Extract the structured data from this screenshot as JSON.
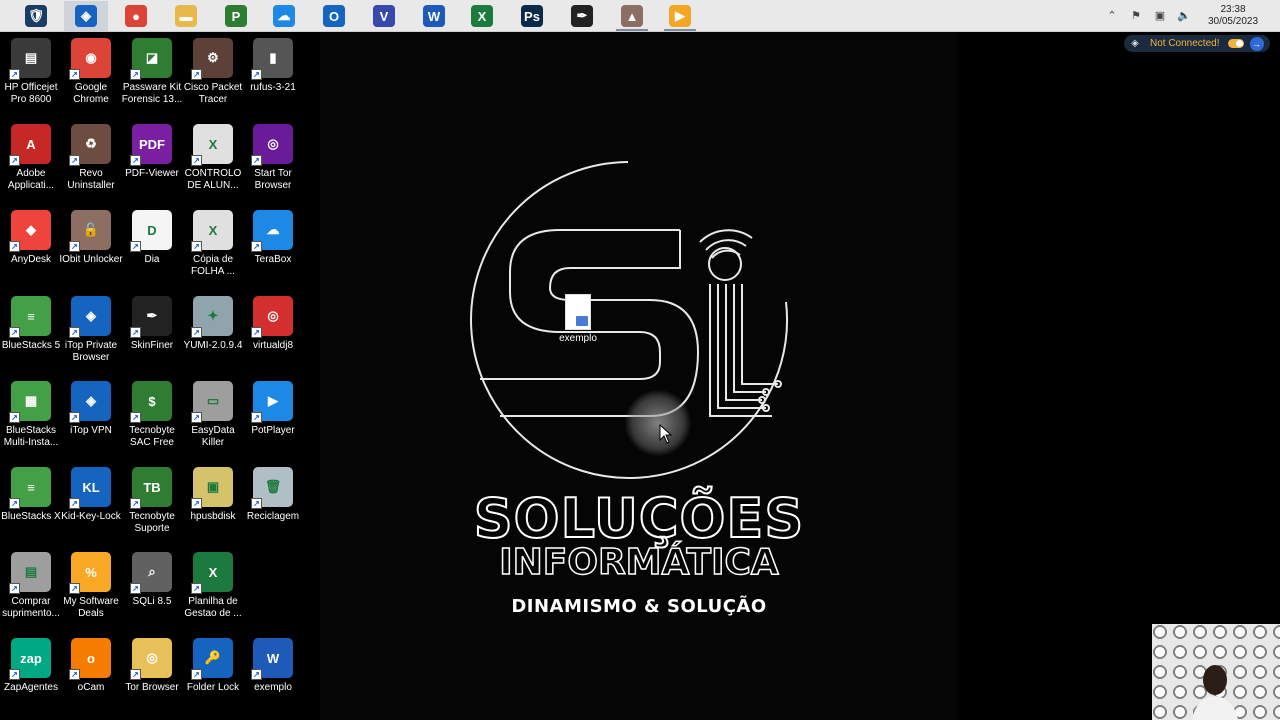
{
  "taskbar": {
    "apps": [
      {
        "name": "Windows Defender Security",
        "icon": "shield-icon",
        "color": "#1a3c64",
        "glyph": "🛡"
      },
      {
        "name": "iTop VPN",
        "icon": "vpn-shield-icon",
        "color": "#1565c0",
        "glyph": "◈",
        "active": true
      },
      {
        "name": "Google Chrome",
        "icon": "chrome-icon",
        "color": "#db4437",
        "glyph": "●"
      },
      {
        "name": "File Explorer",
        "icon": "folder-icon",
        "color": "#e8b84a",
        "glyph": "▬"
      },
      {
        "name": "Project",
        "icon": "project-icon",
        "color": "#2e7d32",
        "glyph": "P"
      },
      {
        "name": "TeraBox",
        "icon": "cloud-upload-icon",
        "color": "#1e88e5",
        "glyph": "☁"
      },
      {
        "name": "Outlook",
        "icon": "outlook-icon",
        "color": "#1565c0",
        "glyph": "O"
      },
      {
        "name": "Visio",
        "icon": "visio-icon",
        "color": "#3949ab",
        "glyph": "V"
      },
      {
        "name": "Word",
        "icon": "word-icon",
        "color": "#1e5bb8",
        "glyph": "W"
      },
      {
        "name": "Excel",
        "icon": "excel-icon",
        "color": "#1d7a3e",
        "glyph": "X"
      },
      {
        "name": "Photoshop",
        "icon": "photoshop-icon",
        "color": "#0b2a4a",
        "glyph": "Ps"
      },
      {
        "name": "SkinFiner",
        "icon": "feather-icon",
        "color": "#222222",
        "glyph": "✒"
      },
      {
        "name": "Taskbar App",
        "icon": "hat-icon",
        "color": "#8d6e63",
        "glyph": "▲",
        "running": true
      },
      {
        "name": "Video Player",
        "icon": "play-icon",
        "color": "#f5a623",
        "glyph": "▶",
        "running": true
      }
    ]
  },
  "tray": {
    "time": "23:38",
    "date": "30/05/2023"
  },
  "vpn_status": {
    "label": "Not Connected!"
  },
  "desktop_icons": [
    {
      "label": "HP Officejet Pro 8600",
      "icon": "printer-icon",
      "color": "#3a3a3a",
      "glyph": "▤"
    },
    {
      "label": "Google Chrome",
      "icon": "chrome-icon",
      "color": "#db4437",
      "glyph": "◉"
    },
    {
      "label": "Passware Kit Forensic 13...",
      "icon": "passware-icon",
      "color": "#2e7d32",
      "glyph": "◪"
    },
    {
      "label": "Cisco Packet Tracer",
      "icon": "cisco-icon",
      "color": "#5d4037",
      "glyph": "⚙"
    },
    {
      "label": "rufus-3-21",
      "icon": "usb-icon",
      "color": "#555555",
      "glyph": "▮"
    },
    {
      "label": "Adobe Applicati...",
      "icon": "adobe-icon",
      "color": "#c62828",
      "glyph": "A"
    },
    {
      "label": "Revo Uninstaller",
      "icon": "revo-icon",
      "color": "#6d4c41",
      "glyph": "♻"
    },
    {
      "label": "PDF-Viewer",
      "icon": "pdf-icon",
      "color": "#7b1fa2",
      "glyph": "PDF"
    },
    {
      "label": "CONTROLO DE ALUN...",
      "icon": "excel-file-icon",
      "color": "#e0e0e0",
      "glyph": "X"
    },
    {
      "label": "Start Tor Browser",
      "icon": "tor-icon",
      "color": "#6a1b9a",
      "glyph": "◎"
    },
    {
      "label": "AnyDesk",
      "icon": "anydesk-icon",
      "color": "#ef443b",
      "glyph": "◆"
    },
    {
      "label": "IObit Unlocker",
      "icon": "unlock-icon",
      "color": "#8d6e63",
      "glyph": "🔓"
    },
    {
      "label": "Dia",
      "icon": "dia-icon",
      "color": "#f5f5f5",
      "glyph": "D"
    },
    {
      "label": "Cópia de FOLHA ...",
      "icon": "excel-file-icon",
      "color": "#e0e0e0",
      "glyph": "X"
    },
    {
      "label": "TeraBox",
      "icon": "cloud-upload-icon",
      "color": "#1e88e5",
      "glyph": "☁"
    },
    {
      "label": "BlueStacks 5",
      "icon": "bluestacks-icon",
      "color": "#43a047",
      "glyph": "≡"
    },
    {
      "label": "iTop Private Browser",
      "icon": "itop-browser-icon",
      "color": "#1565c0",
      "glyph": "◈"
    },
    {
      "label": "SkinFiner",
      "icon": "feather-icon",
      "color": "#222222",
      "glyph": "✒"
    },
    {
      "label": "YUMI-2.0.9.4",
      "icon": "yumi-icon",
      "color": "#90a4ae",
      "glyph": "✦"
    },
    {
      "label": "virtualdj8",
      "icon": "vdj-icon",
      "color": "#d32f2f",
      "glyph": "◎"
    },
    {
      "label": "BlueStacks Multi-Insta...",
      "icon": "bluestacks-multi-icon",
      "color": "#43a047",
      "glyph": "▦"
    },
    {
      "label": "iTop VPN",
      "icon": "vpn-shield-icon",
      "color": "#1565c0",
      "glyph": "◈"
    },
    {
      "label": "Tecnobyte SAC Free",
      "icon": "tecnobyte-icon",
      "color": "#2e7d32",
      "glyph": "$"
    },
    {
      "label": "EasyData Killer",
      "icon": "harddisk-icon",
      "color": "#9e9e9e",
      "glyph": "▭"
    },
    {
      "label": "PotPlayer",
      "icon": "play-icon",
      "color": "#1e88e5",
      "glyph": "▶"
    },
    {
      "label": "BlueStacks X",
      "icon": "bluestacks-x-icon",
      "color": "#43a047",
      "glyph": "≡"
    },
    {
      "label": "Kid-Key-Lock",
      "icon": "key-icon",
      "color": "#1565c0",
      "glyph": "KL"
    },
    {
      "label": "Tecnobyte Suporte",
      "icon": "tecnobyte-icon",
      "color": "#2e7d32",
      "glyph": "TB"
    },
    {
      "label": "hpusbdisk",
      "icon": "usbdisk-icon",
      "color": "#d4c36a",
      "glyph": "▣"
    },
    {
      "label": "Reciclagem",
      "icon": "recycle-bin-icon",
      "color": "#b0bec5",
      "glyph": "🗑"
    },
    {
      "label": "Comprar suprimento...",
      "icon": "printer-cart-icon",
      "color": "#9e9e9e",
      "glyph": "▤"
    },
    {
      "label": "My Software Deals",
      "icon": "cart-icon",
      "color": "#f9a825",
      "glyph": "%"
    },
    {
      "label": "SQLi 8.5",
      "icon": "magnifier-icon",
      "color": "#616161",
      "glyph": "⌕"
    },
    {
      "label": "Planilha de Gestao de ...",
      "icon": "excel-file-icon",
      "color": "#1d7a3e",
      "glyph": "X"
    },
    {
      "label": "ZapAgentes",
      "icon": "zap-icon",
      "color": "#00a884",
      "glyph": "zap"
    },
    {
      "label": "oCam",
      "icon": "ocam-icon",
      "color": "#f57c00",
      "glyph": "o"
    },
    {
      "label": "Tor Browser",
      "icon": "tor-folder-icon",
      "color": "#e8c05a",
      "glyph": "◎"
    },
    {
      "label": "Folder Lock",
      "icon": "folder-lock-icon",
      "color": "#1565c0",
      "glyph": "🔑"
    },
    {
      "label": "exemplo",
      "icon": "word-doc-icon",
      "color": "#1e5bb8",
      "glyph": "W"
    }
  ],
  "wallpaper": {
    "brand_line_1": "SOLUÇÕES",
    "brand_line_2": "INFORMÁTICA",
    "brand_line_3": "DINAMISMO & SOLUÇÃO",
    "file_label": "exemplo"
  }
}
